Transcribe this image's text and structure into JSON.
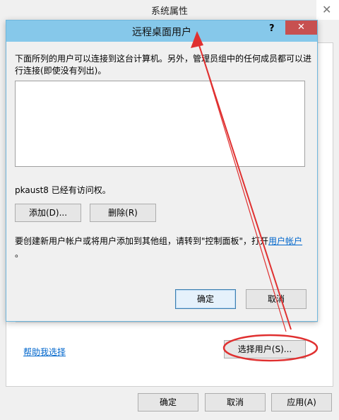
{
  "outer_window": {
    "title": "系统属性",
    "help_link": "帮助我选择",
    "select_users_button": "选择用户(S)...",
    "ok_button": "确定",
    "cancel_button": "取消",
    "apply_button": "应用(A)",
    "close_glyph": "✕"
  },
  "dialog": {
    "title": "远程桌面用户",
    "help_glyph": "?",
    "close_glyph": "✕",
    "intro_text": "下面所列的用户可以连接到这台计算机。另外，管理员组中的任何成员都可以进行连接(即使没有列出)。",
    "user_list": [],
    "access_text": "pkaust8 已经有访问权。",
    "add_button": "添加(D)...",
    "remove_button": "删除(R)",
    "note_prefix": "要创建新用户帐户或将用户添加到其他组，请转到\"控制面板\"，打开",
    "note_link": "用户帐户",
    "note_suffix": "。",
    "ok_button": "确定",
    "cancel_button": "取消"
  },
  "annotation": {
    "color": "#e03030"
  }
}
